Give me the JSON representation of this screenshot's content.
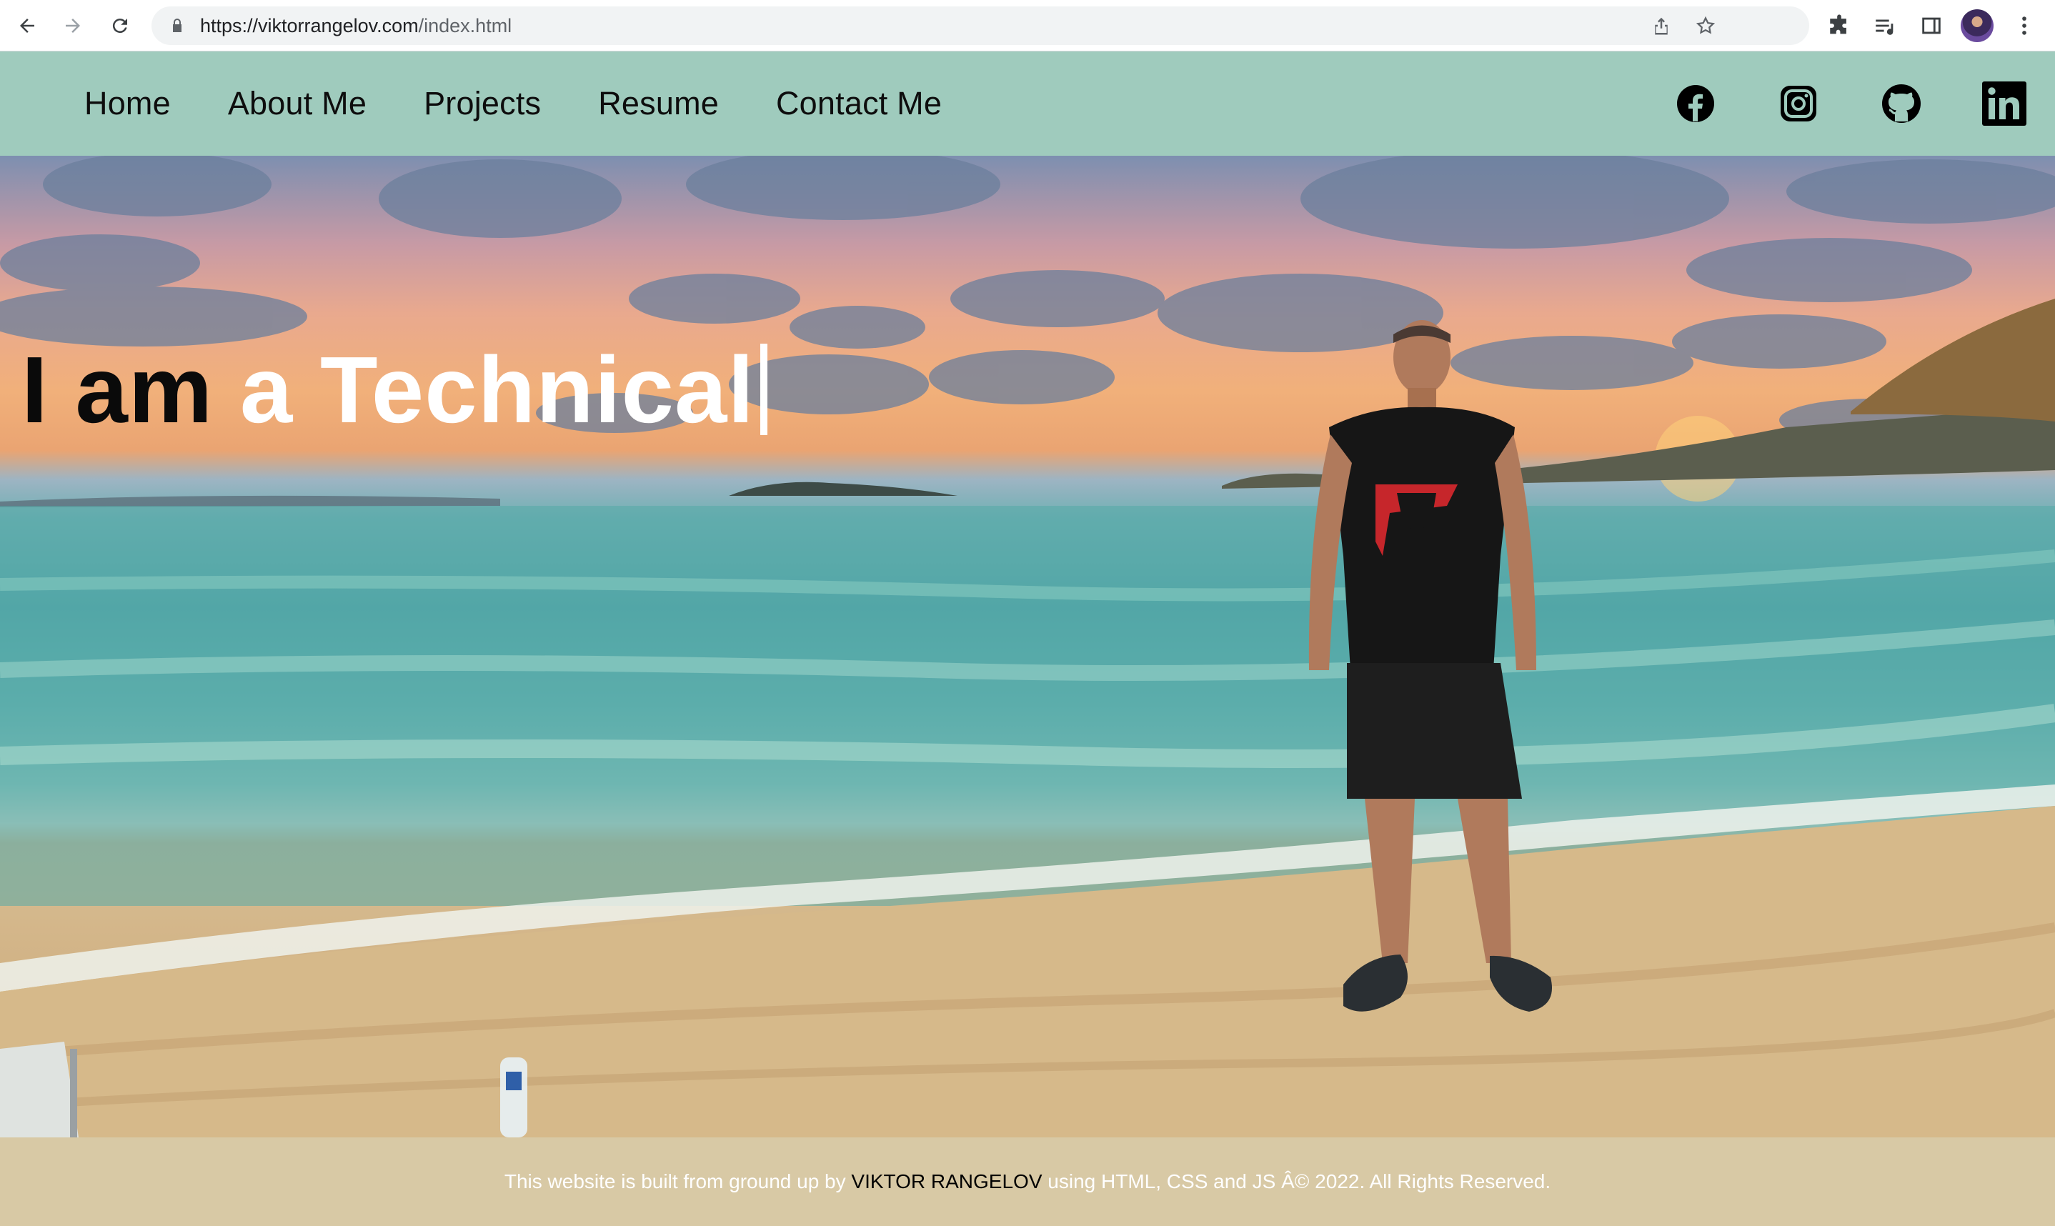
{
  "browser": {
    "url_host": "https://viktorrangelov.com",
    "url_path": "/index.html",
    "icons": [
      "back-arrow-icon",
      "forward-arrow-icon",
      "reload-icon",
      "lock-icon",
      "share-icon",
      "star-icon",
      "extensions-icon",
      "reading-list-icon",
      "side-panel-icon",
      "profile-avatar",
      "kebab-menu-icon"
    ]
  },
  "nav": {
    "links": [
      "Home",
      "About Me",
      "Projects",
      "Resume",
      "Contact Me"
    ],
    "social": [
      "facebook-icon",
      "instagram-icon",
      "github-icon",
      "linkedin-icon"
    ],
    "background": "#9fcbbd"
  },
  "hero": {
    "headline_dark_1": "I",
    "headline_dark_2": "am",
    "headline_light": "a Technical"
  },
  "footer": {
    "text_before": "This website is built from ground up by",
    "author": "VIKTOR RANGELOV",
    "text_after": "using HTML, CSS and JS Â© 2022. All Rights Reserved.",
    "background": "#d8c9a5"
  }
}
